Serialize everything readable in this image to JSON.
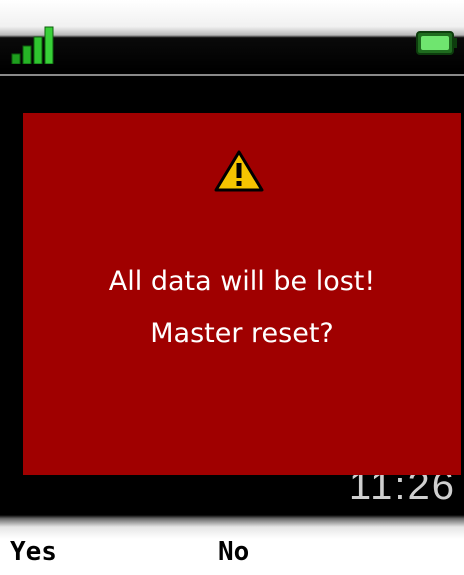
{
  "status": {
    "signal_icon": "signal-strength-icon",
    "battery_icon": "battery-full-icon",
    "clock": "11:26"
  },
  "dialog": {
    "icon": "warning-icon",
    "background_color": "#a00000",
    "message_line1": "All data will be lost!",
    "message_line2": "Master reset?"
  },
  "softkeys": {
    "left_label": "Yes",
    "center_label": "No"
  }
}
